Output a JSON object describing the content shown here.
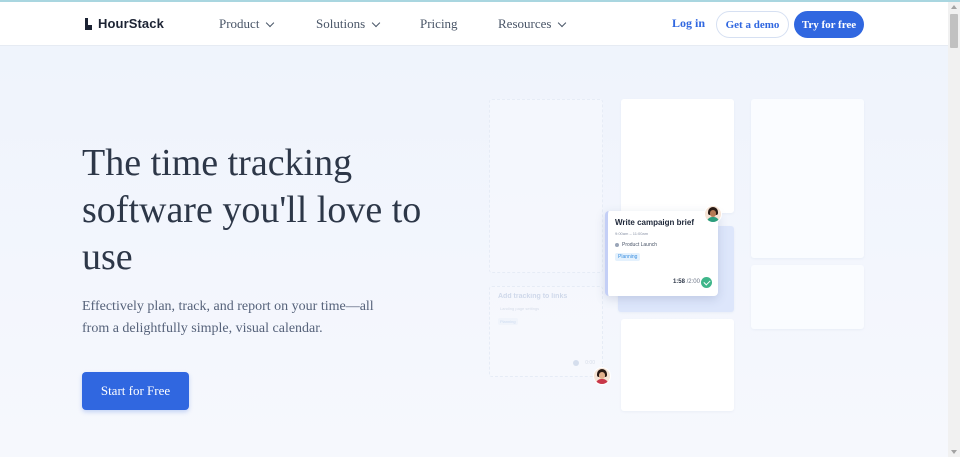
{
  "brand": {
    "name": "HourStack"
  },
  "nav": {
    "items": [
      {
        "label": "Product",
        "has_dropdown": true
      },
      {
        "label": "Solutions",
        "has_dropdown": true
      },
      {
        "label": "Pricing",
        "has_dropdown": false
      },
      {
        "label": "Resources",
        "has_dropdown": true
      }
    ],
    "login": "Log in",
    "demo": "Get a demo",
    "try": "Try for free"
  },
  "hero": {
    "headline": "The time tracking software you'll love to use",
    "subtext": "Effectively plan, track, and report on your time—all from a delightfully simple, visual calendar.",
    "cta": "Start for Free"
  },
  "illustration": {
    "card": {
      "title": "Write campaign brief",
      "time": "9:00am – 11:00am",
      "project": "Product Launch",
      "tag": "Planning",
      "tracked": "1:58",
      "estimate": "/2:00"
    },
    "ghost_card": {
      "title": "Add tracking to links",
      "sub": "Landing page settings",
      "tag": "Planning",
      "time": "0:00"
    }
  },
  "colors": {
    "accent": "#3067e0",
    "heading": "#2d3748",
    "body_text": "#56627a",
    "background": "#eef3fc",
    "success": "#3fb68a"
  }
}
